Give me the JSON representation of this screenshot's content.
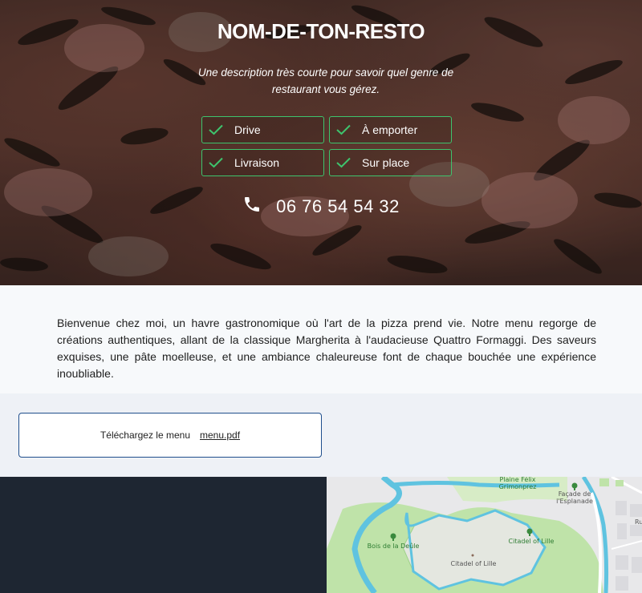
{
  "hero": {
    "title": "NOM-DE-TON-RESTO",
    "description": "Une description très courte pour savoir quel genre de restaurant vous gérez.",
    "services": [
      {
        "label": "Drive"
      },
      {
        "label": "À emporter"
      },
      {
        "label": "Livraison"
      },
      {
        "label": "Sur place"
      }
    ],
    "phone": "06 76 54 54 32",
    "icons": {
      "check": "check-icon",
      "phone": "phone-icon"
    },
    "accent_color": "#3ec46d"
  },
  "intro": {
    "text": "Bienvenue chez moi, un havre gastronomique où l'art de la pizza prend vie. Notre menu regorge de créations authentiques, allant de la classique Margherita à l'audacieuse Quattro Formaggi. Des saveurs exquises, une pâte moelleuse, et une ambiance chaleureuse font de chaque bouchée une expérience inoubliable."
  },
  "download": {
    "label": "Téléchargez le menu",
    "file": "menu.pdf",
    "border_color": "#1f4e8c"
  },
  "map": {
    "labels": {
      "plaine": "Plaine Félix Grimonprez",
      "facade": "Façade de l'Esplanade",
      "bois": "Bois de la Deûle",
      "citadel_green": "Citadel of Lille",
      "citadel": "Citadel of Lille",
      "edge": "Ru"
    }
  }
}
